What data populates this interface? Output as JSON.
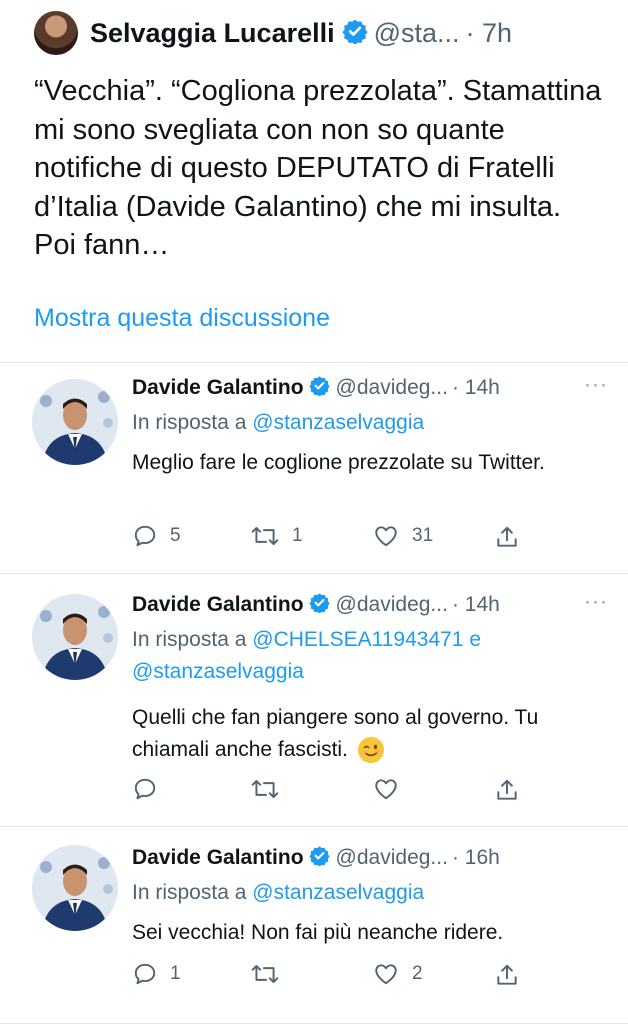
{
  "main_tweet": {
    "name": "Selvaggia Lucarelli",
    "handle": "@sta...",
    "time": "· 7h",
    "text": "“Vecchia”. “Cogliona prezzolata”. Stamattina mi sono svegliata con non so quante notifiche di questo DEPUTATO di Fratelli d’Italia (Davide Galantino) che mi insulta. Poi fann…",
    "show_thread": "Mostra questa discussione"
  },
  "replies": [
    {
      "name": "Davide Galantino",
      "handle": "@davideg...",
      "time": "· 14h",
      "more": "···",
      "reply_to_prefix": "In risposta a",
      "mentions": "@stanzaselvaggia",
      "mentions_2": "",
      "text": "Meglio fare le coglione prezzolate su Twitter.",
      "reply_count": "5",
      "retweet_count": "1",
      "like_count": "31"
    },
    {
      "name": "Davide Galantino",
      "handle": "@davideg...",
      "time": "· 14h",
      "more": "···",
      "reply_to_prefix": "In risposta a",
      "mentions": "@CHELSEA11943471 e",
      "mentions_2": "@stanzaselvaggia",
      "text": "Quelli che fan piangere sono al governo. Tu chiamali anche fascisti.",
      "reply_count": "",
      "retweet_count": "",
      "like_count": ""
    },
    {
      "name": "Davide Galantino",
      "handle": "@davideg...",
      "time": "· 16h",
      "more": "···",
      "reply_to_prefix": "In risposta a",
      "mentions": "@stanzaselvaggia",
      "mentions_2": "",
      "text": "Sei vecchia! Non fai più neanche ridere.",
      "reply_count": "1",
      "retweet_count": "",
      "like_count": "2"
    }
  ],
  "colors": {
    "accent": "#1d9bf0",
    "secondary": "#536471",
    "divider": "#e1e4e8"
  },
  "icons": [
    "verified-badge-icon",
    "reply-icon",
    "retweet-icon",
    "like-icon",
    "share-icon",
    "more-icon",
    "wink-emoji-icon"
  ]
}
